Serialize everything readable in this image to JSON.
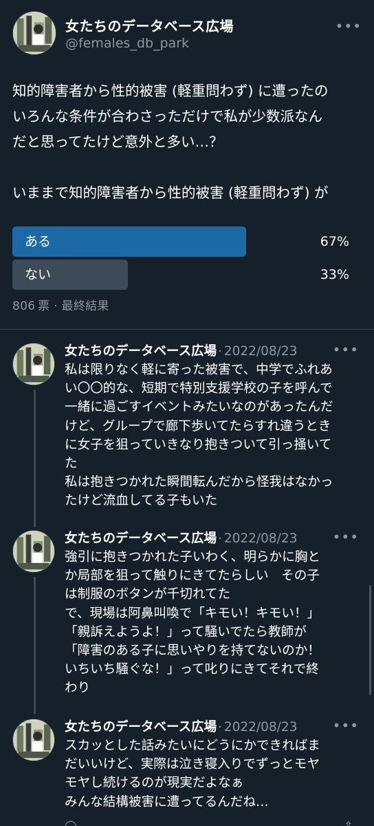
{
  "account": {
    "display_name": "女たちのデータベース広場",
    "handle": "@females_db_park"
  },
  "tweet": {
    "lines": [
      "知的障害者から性的被害 (軽重問わず) に遭ったの",
      "いろんな条件が合わさっただけで私が少数派なん",
      "だと思ってたけど意外と多い…？",
      "",
      "いままで知的障害者から性的被害 (軽重問わず) が"
    ]
  },
  "poll": {
    "options": [
      {
        "label": "ある",
        "percent": "67%",
        "fraction": 0.67,
        "color": "#1d69a6"
      },
      {
        "label": "ない",
        "percent": "33%",
        "fraction": 0.33,
        "color": "#3d4a57"
      }
    ],
    "votes": "806",
    "votes_unit": "票",
    "separator": "·",
    "status": "最終結果"
  },
  "replies": [
    {
      "name": "女たちのデータベース広場",
      "separator": "·",
      "date": "2022/08/23",
      "lines": [
        "私は限りなく軽に寄った被害で、中学でふれあ",
        "い〇〇的な、短期で特別支援学校の子を呼んで",
        "一緒に過ごすイベントみたいなのがあったんだ",
        "けど、グループで廊下歩いてたらすれ違うとき",
        "に女子を狙っていきなり抱きついて引っ掻いて",
        "た",
        "私は抱きつかれた瞬間転んだから怪我はなかっ",
        "たけど流血してる子もいた"
      ]
    },
    {
      "name": "女たちのデータベース広場",
      "separator": "·",
      "date": "2022/08/23",
      "lines": [
        "強引に抱きつかれた子いわく、明らかに胸と",
        "か局部を狙って触りにきてたらしい　その子",
        "は制服のボタンが千切れてた",
        "で、現場は阿鼻叫喚で「キモい！キモい！」",
        "「親訴えようよ！」って騒いでたら教師が",
        "「障害のある子に思いやりを持てないのか！",
        "いちいち騒ぐな！」って叱りにきてそれで終",
        "わり"
      ]
    },
    {
      "name": "女たちのデータベース広場",
      "separator": "·",
      "date": "2022/08/23",
      "lines": [
        "スカッとした話みたいにどうにかできればま",
        "だいいけど、実際は泣き寝入りでずっとモヤ",
        "モヤし続けるのが現実だよなぁ",
        "みんな結構被害に遭ってるんだね…"
      ]
    }
  ],
  "icons": {
    "more": "more-horizontal-icon",
    "reply": "reply-icon",
    "share": "share-icon"
  },
  "colors": {
    "background": "#15202b",
    "text": "#ffffff",
    "secondary_text": "#8b98a5",
    "poll_leading": "#1d69a6",
    "poll_other": "#3d4a57"
  }
}
